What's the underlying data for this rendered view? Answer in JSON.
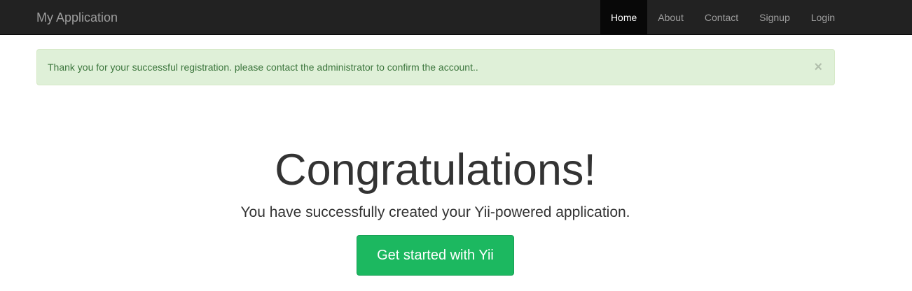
{
  "navbar": {
    "brand": "My Application",
    "items": [
      {
        "label": "Home",
        "active": true
      },
      {
        "label": "About",
        "active": false
      },
      {
        "label": "Contact",
        "active": false
      },
      {
        "label": "Signup",
        "active": false
      },
      {
        "label": "Login",
        "active": false
      }
    ]
  },
  "alert": {
    "message": "Thank you for your successful registration. please contact the administrator to confirm the account..",
    "close_glyph": "×",
    "type": "success"
  },
  "jumbotron": {
    "heading": "Congratulations!",
    "lead": "You have successfully created your Yii-powered application.",
    "button_label": "Get started with Yii"
  },
  "colors": {
    "navbar_bg": "#222222",
    "alert_bg": "#dff0d8",
    "alert_text": "#3c763d",
    "button_bg": "#1cb860"
  }
}
